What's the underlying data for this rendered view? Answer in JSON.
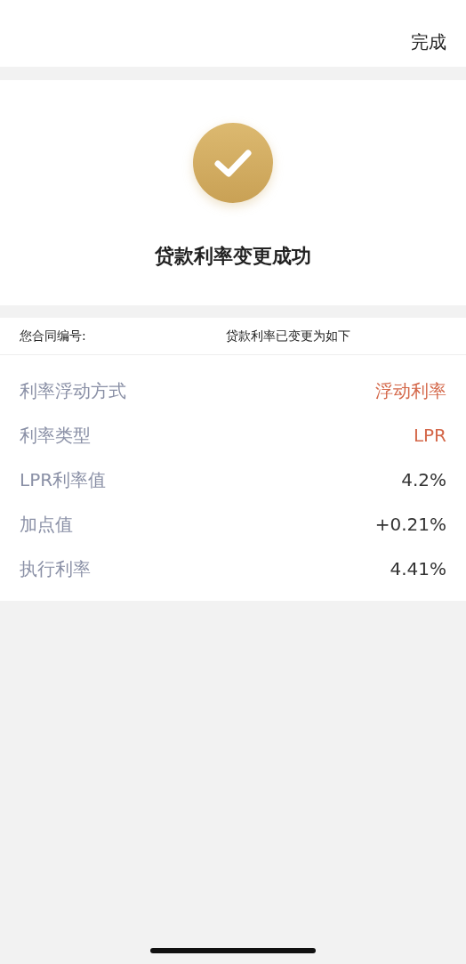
{
  "nav": {
    "done_button": "完成"
  },
  "result": {
    "title": "贷款利率变更成功"
  },
  "details": {
    "contract_label": "您合同编号:",
    "note": "贷款利率已变更为如下",
    "rows": [
      {
        "label": "利率浮动方式",
        "value": "浮动利率",
        "highlight": true
      },
      {
        "label": "利率类型",
        "value": "LPR",
        "highlight": true
      },
      {
        "label": "LPR利率值",
        "value": "4.2%",
        "highlight": false
      },
      {
        "label": "加点值",
        "value": "+0.21%",
        "highlight": false
      },
      {
        "label": "执行利率",
        "value": "4.41%",
        "highlight": false
      }
    ]
  }
}
